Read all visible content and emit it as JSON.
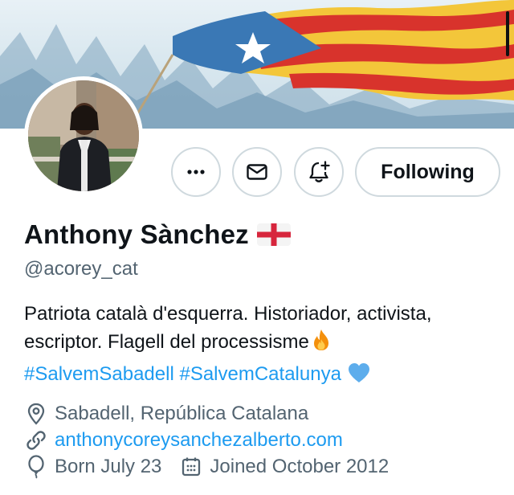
{
  "profile": {
    "display_name": "Anthony Sànchez",
    "handle": "@acorey_cat",
    "bio_line1": "Patriota català d'esquerra. Historiador, activista,",
    "bio_line2": "escriptor. Flagell del processisme",
    "bio_hashtag1": "#SalvemSabadell",
    "bio_hashtag2": "#SalvemCatalunya",
    "location": "Sabadell, República Catalana",
    "website": "anthonycoreysanchezalberto.com",
    "birthday": "Born July 23",
    "joined": "Joined October 2012"
  },
  "actions": {
    "following_label": "Following"
  },
  "icons": {
    "more": "more-icon",
    "message": "envelope-icon",
    "notify": "bell-plus-icon",
    "location": "location-pin-icon",
    "link": "link-icon",
    "birthday": "balloon-icon",
    "calendar": "calendar-icon",
    "fire": "fire-emoji",
    "heart": "blue-heart-emoji",
    "flag": "england-flag-emoji"
  },
  "colors": {
    "accent": "#1d9bf0",
    "muted_text": "#536471",
    "primary_text": "#0f1419",
    "border": "#cfd9de"
  }
}
